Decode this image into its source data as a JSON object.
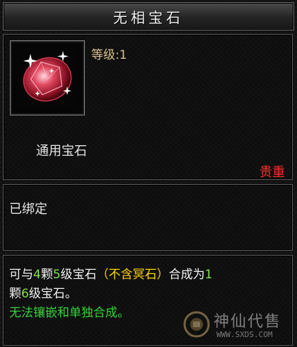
{
  "item": {
    "name": "无相宝石",
    "level_text": "等级:1",
    "category": "通用宝石",
    "rarity": "贵重",
    "bind_status": "已绑定",
    "icon": "red-gem-icon"
  },
  "description": {
    "p1": "可与",
    "qty": "4",
    "p2": "颗",
    "level_from": "5",
    "p3": "级宝石",
    "note": "（不含冥石）",
    "p4": "合成为",
    "result_qty": "1",
    "p5": "颗",
    "level_to": "6",
    "p6": "级宝石。",
    "warning": "无法镶嵌和单独合成。"
  },
  "watermark": {
    "title": "神仙代售",
    "url": "WWW.SXDS.COM"
  },
  "colors": {
    "rarity": "#ff2a2a",
    "highlight_number": "#7fe34a",
    "bracket_note": "#ffd400",
    "warning": "#36d23a"
  }
}
